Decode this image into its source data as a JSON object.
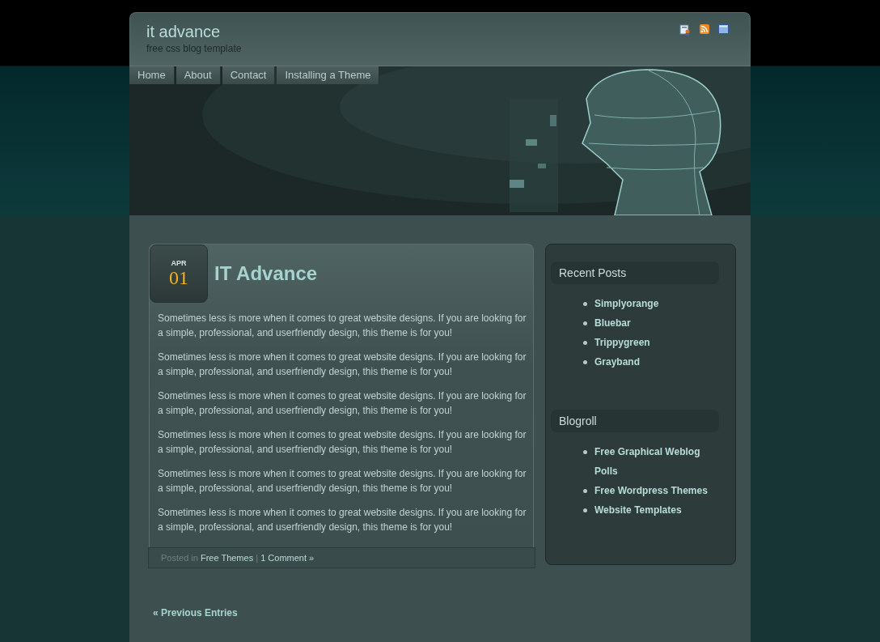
{
  "header": {
    "title": "it advance",
    "tagline": "free css blog template"
  },
  "nav": [
    {
      "label": "Home"
    },
    {
      "label": "About"
    },
    {
      "label": "Contact"
    },
    {
      "label": "Installing a Theme"
    }
  ],
  "post": {
    "month": "APR",
    "day": "01",
    "title": "IT Advance",
    "paragraphs": [
      "Sometimes less is more when it comes to great website designs. If you are looking for a simple, professional, and userfriendly design, this theme is for you!",
      "Sometimes less is more when it comes to great website designs. If you are looking for a simple, professional, and userfriendly design, this theme is for you!",
      "Sometimes less is more when it comes to great website designs. If you are looking for a simple, professional, and userfriendly design, this theme is for you!",
      "Sometimes less is more when it comes to great website designs. If you are looking for a simple, professional, and userfriendly design, this theme is for you!",
      "Sometimes less is more when it comes to great website designs. If you are looking for a simple, professional, and userfriendly design, this theme is for you!",
      "Sometimes less is more when it comes to great website designs. If you are looking for a simple, professional, and userfriendly design, this theme is for you!"
    ],
    "meta": {
      "label": "Posted in",
      "category": "Free Themes",
      "separator": "|",
      "comments": "1 Comment »"
    }
  },
  "previous_entries": "« Previous Entries",
  "sidebar": [
    {
      "title": "Recent Posts",
      "items": [
        "Simplyorange",
        "Bluebar",
        "Trippygreen",
        "Grayband"
      ]
    },
    {
      "title": "Blogroll",
      "items": [
        "Free Graphical Weblog Polls",
        "Free Wordpress Themes",
        "Website Templates"
      ]
    }
  ]
}
